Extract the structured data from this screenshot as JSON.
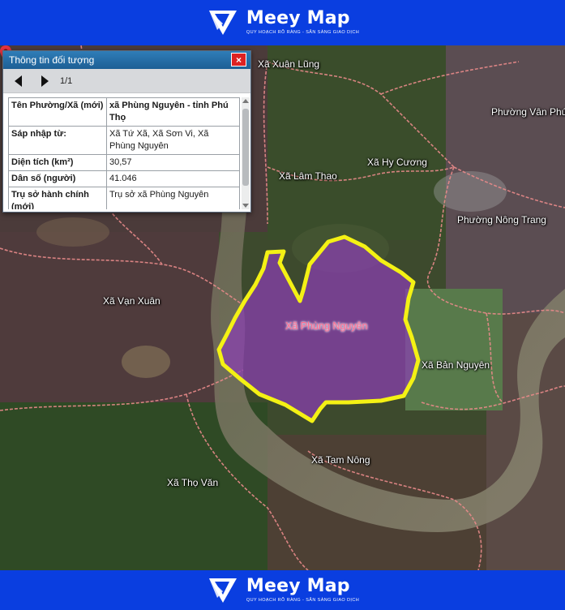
{
  "brand": {
    "name": "Meey Map",
    "tagline": "QUY HOẠCH RÕ RÀNG - SẴN SÀNG GIAO DỊCH"
  },
  "colors": {
    "banner": "#0a3ee0",
    "highlight_border": "#f4f114",
    "highlight_fill": "#8a3fb3",
    "boundary": "#e98a8a",
    "pin": "#e63240"
  },
  "panel": {
    "title": "Thông tin đối tượng",
    "close_label": "×",
    "page_indicator": "1/1",
    "rows": [
      {
        "key": "Tên Phường/Xã (mới)",
        "value": "xã Phùng Nguyên - tỉnh Phú Thọ"
      },
      {
        "key": "Sáp nhập từ:",
        "value": "Xã Tứ Xã, Xã Sơn Vi, Xã Phùng Nguyên"
      },
      {
        "key": "Diện tích (km²)",
        "value": "30,57"
      },
      {
        "key": "Dân số (người)",
        "value": "41.046"
      },
      {
        "key": "Trụ sở hành chính (mới)",
        "value": "Trụ sở xã Phùng Nguyên"
      }
    ]
  },
  "map": {
    "labels": {
      "xuan_lung": "Xã Xuân Lũng",
      "van_phu": "Phường Vân Phú",
      "hy_cuong": "Xã Hy Cương",
      "lam_thao": "Xã Lâm Thao",
      "nong_trang": "Phường Nông Trang",
      "van_xuan": "Xã Vạn Xuân",
      "phung_nguyen": "Xã Phùng Nguyên",
      "ban_nguyen": "Xã Bản Nguyên",
      "tam_nong": "Xã Tam Nông",
      "tho_van": "Xã Thọ Văn"
    }
  }
}
